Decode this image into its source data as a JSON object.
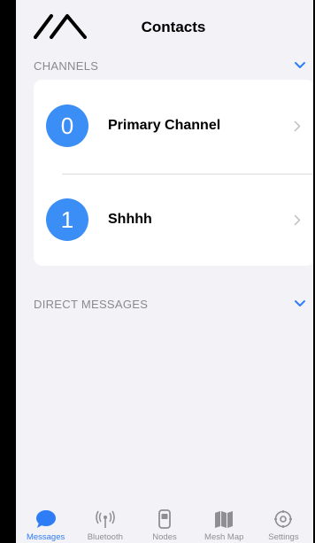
{
  "header": {
    "title": "Contacts",
    "logo_icon": "meshtastic-logo-icon"
  },
  "channels": {
    "section_label": "CHANNELS",
    "items": [
      {
        "index": "0",
        "label": "Primary Channel"
      },
      {
        "index": "1",
        "label": "Shhhh"
      }
    ]
  },
  "direct_messages": {
    "section_label": "DIRECT MESSAGES"
  },
  "tabs": [
    {
      "label": "Messages",
      "icon": "message-bubble-icon",
      "active": true
    },
    {
      "label": "Bluetooth",
      "icon": "antenna-icon",
      "active": false
    },
    {
      "label": "Nodes",
      "icon": "device-icon",
      "active": false
    },
    {
      "label": "Mesh Map",
      "icon": "map-icon",
      "active": false
    },
    {
      "label": "Settings",
      "icon": "gear-icon",
      "active": false
    }
  ],
  "colors": {
    "accent": "#2f7df6",
    "badge": "#3a8ef6",
    "background": "#f2f2f7"
  }
}
